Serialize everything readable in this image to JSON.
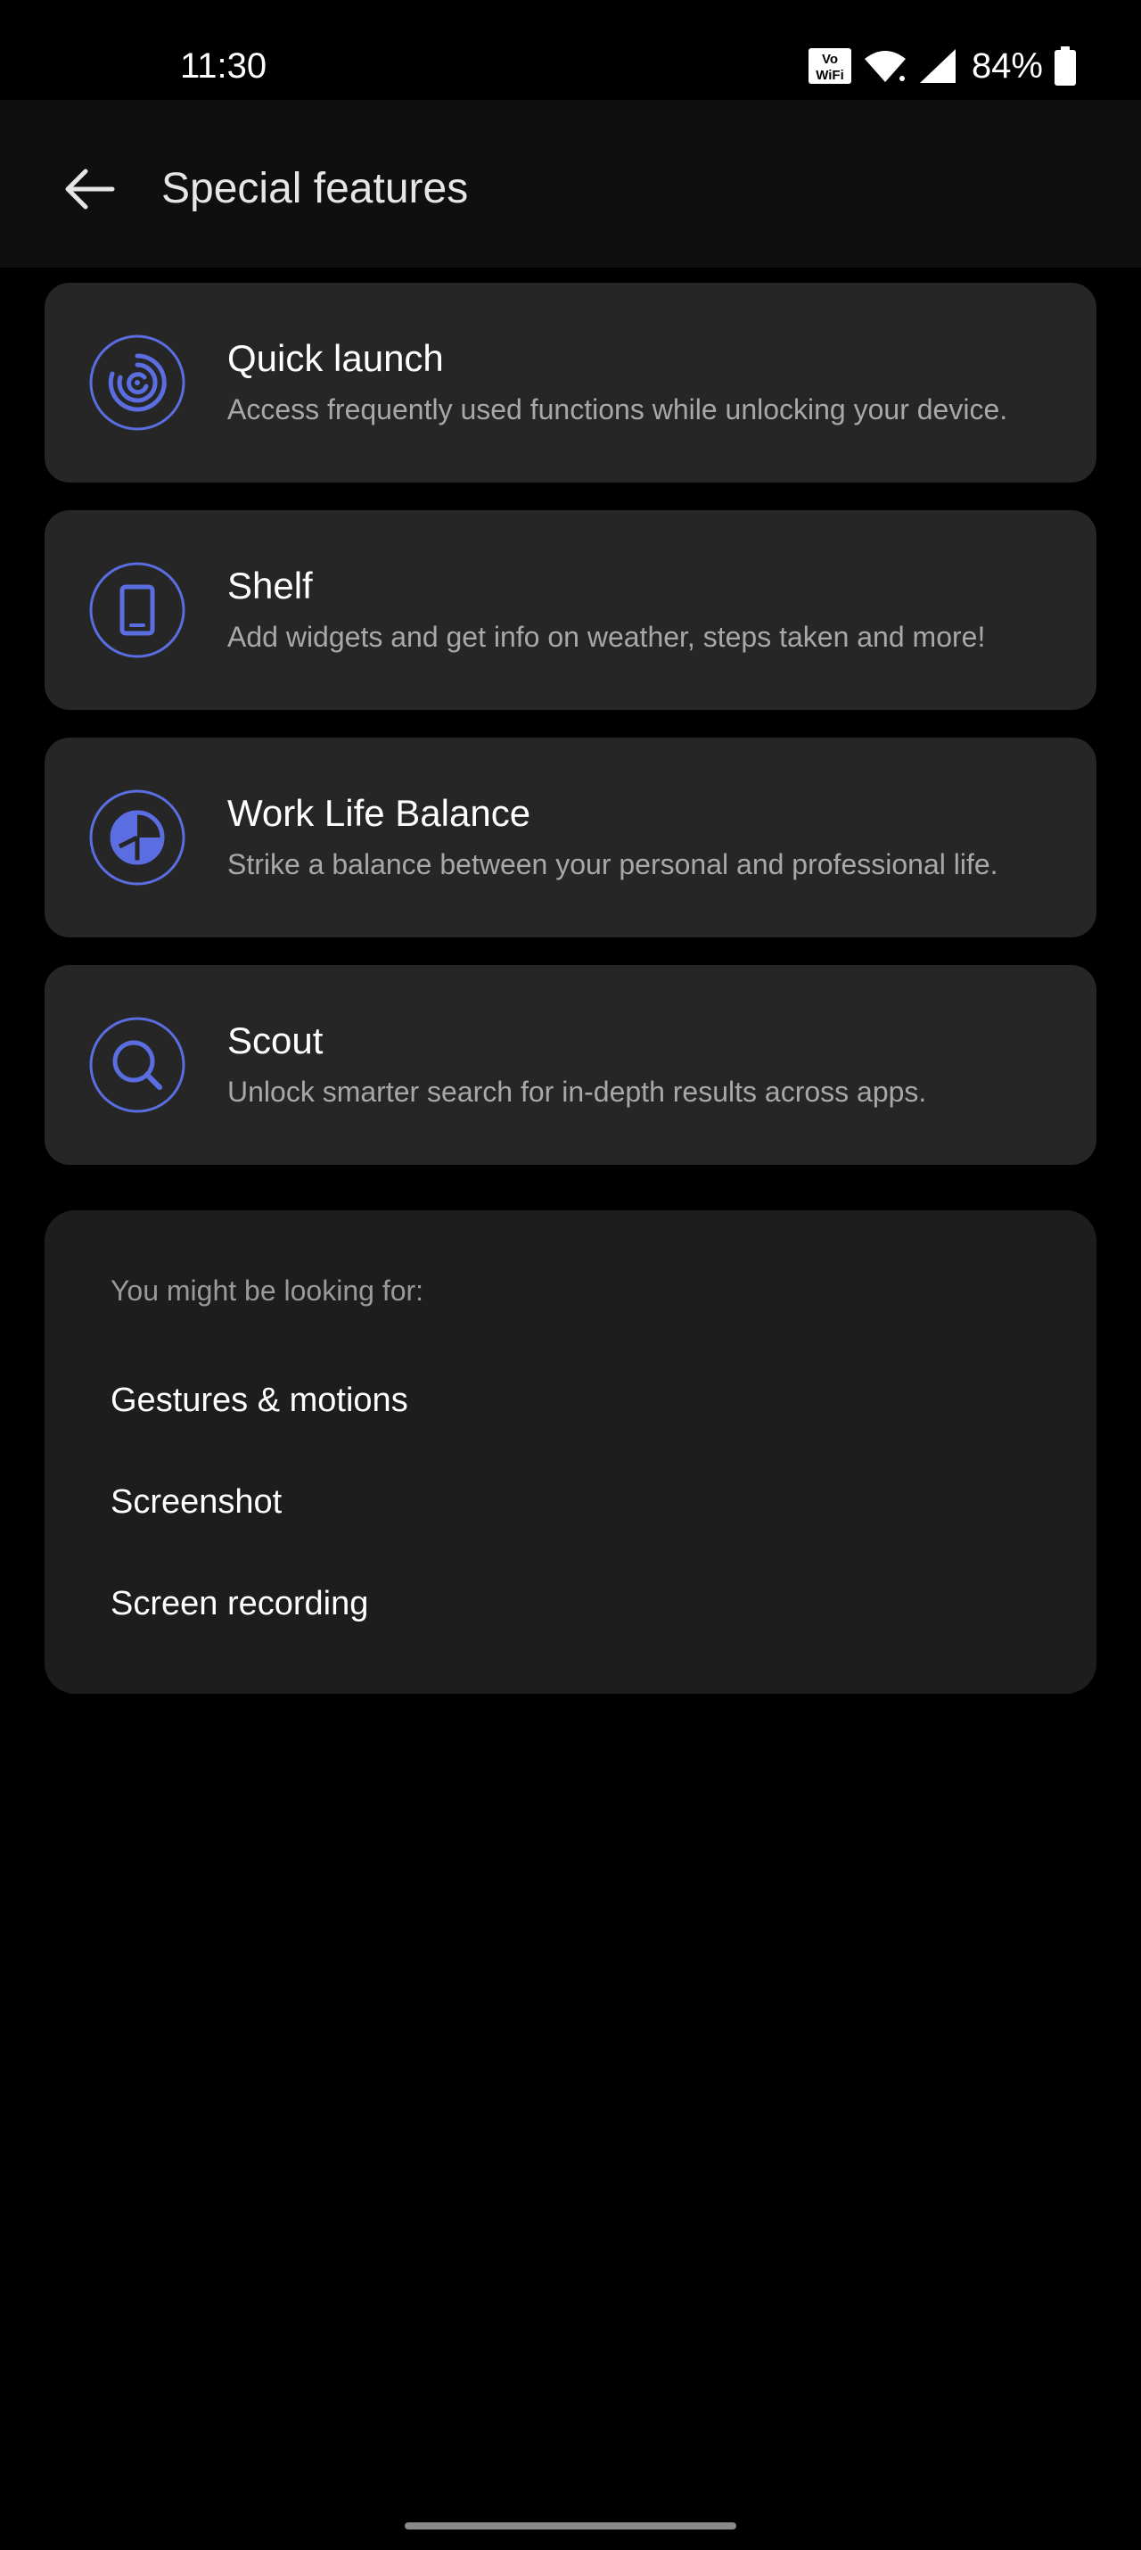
{
  "status_bar": {
    "time": "11:30",
    "battery_percent": "84%",
    "icons": [
      "vowifi-icon",
      "wifi-icon",
      "cell-signal-icon",
      "battery-icon"
    ],
    "vowifi_top": "Vo",
    "vowifi_bottom": "WiFi"
  },
  "app_bar": {
    "title": "Special features",
    "back_icon": "arrow-left-icon"
  },
  "features": [
    {
      "title": "Quick launch",
      "description": "Access frequently used functions while unlocking your device.",
      "icon": "fingerprint-target-icon"
    },
    {
      "title": "Shelf",
      "description": "Add widgets and get info on weather, steps taken and more!",
      "icon": "phone-icon"
    },
    {
      "title": "Work Life Balance",
      "description": "Strike a balance between your personal and professional life.",
      "icon": "balance-icon"
    },
    {
      "title": "Scout",
      "description": "Unlock smarter search for in-depth results across apps.",
      "icon": "search-icon"
    }
  ],
  "suggestions": {
    "heading": "You might be looking for:",
    "items": [
      "Gestures & motions",
      "Screenshot",
      "Screen recording"
    ]
  },
  "colors": {
    "accent": "#5b6ee1",
    "background": "#000000",
    "card": "#262626",
    "suggestions_card": "#1d1d1d",
    "secondary_text": "#a8a8a8"
  }
}
